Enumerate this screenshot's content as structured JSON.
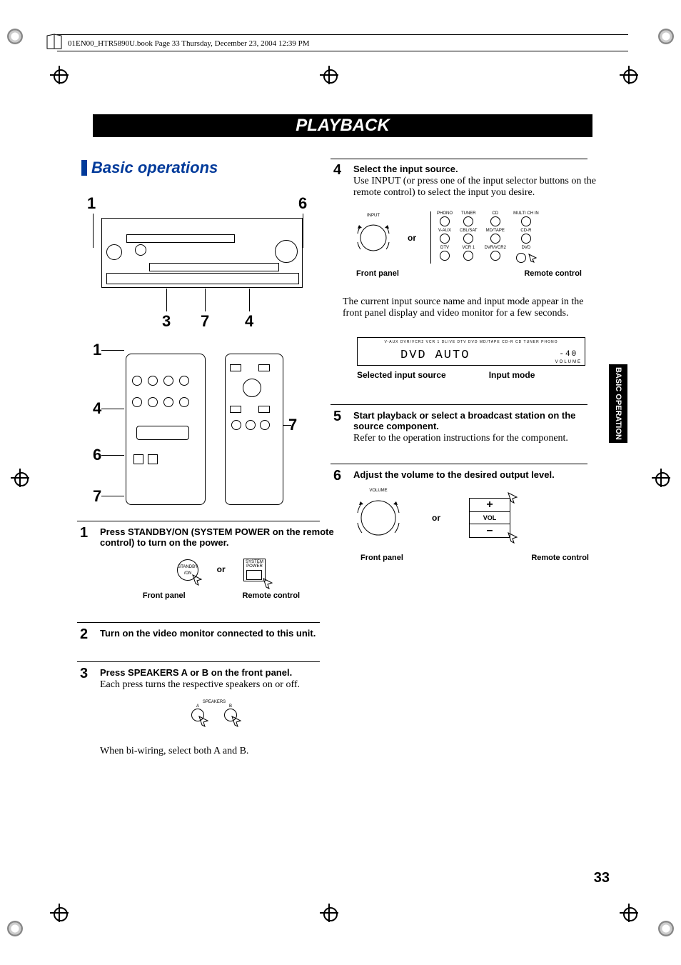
{
  "header_line": "01EN00_HTR5890U.book  Page 33  Thursday, December 23, 2004  12:39 PM",
  "title": "PLAYBACK",
  "section_title": "Basic operations",
  "side_tab": "BASIC OPERATION",
  "page_number": "33",
  "front_callouts": {
    "c1": "1",
    "c3": "3",
    "c4": "4",
    "c6": "6",
    "c7": "7",
    "r1": "1",
    "r4": "4",
    "r6": "6",
    "r7": "7",
    "r7b": "7"
  },
  "steps": {
    "s1": {
      "num": "1",
      "head": "Press STANDBY/ON (SYSTEM POWER on the remote control) to turn on the power.",
      "front_panel": "Front panel",
      "remote_control": "Remote control",
      "standby_label": "STANDBY\n/ON",
      "system_power_top": "SYSTEM",
      "system_power_bot": "POWER",
      "or": "or"
    },
    "s2": {
      "num": "2",
      "head": "Turn on the video monitor connected to this unit."
    },
    "s3": {
      "num": "3",
      "head": "Press SPEAKERS A or B on the front panel.",
      "body": "Each press turns the respective speakers on or off.",
      "body2": "When bi-wiring, select both A and B.",
      "speakers_lbl": "SPEAKERS",
      "a": "A",
      "b": "B"
    },
    "s4": {
      "num": "4",
      "head": "Select the input source.",
      "body": "Use INPUT (or press one of the input selector buttons on the remote control) to select the input you desire.",
      "input_lbl": "INPUT",
      "front_panel": "Front panel",
      "remote_control": "Remote control",
      "or": "or",
      "rc_inputs": [
        "PHONO",
        "TUNER",
        "CD",
        "MULTI CH IN",
        "V-AUX",
        "CBL/SAT",
        "MD/TAPE",
        "CD-R",
        "DTV",
        "VCR 1",
        "DVR/VCR2",
        "DVD"
      ],
      "body2": "The current input source name and input mode appear in the front panel display and video monitor for a few seconds.",
      "disp_labels": "V-AUX  DVR/VCR2  VCR 1  DLIVE  DTV  DVD  MD/TAPE  CD-R  CD  TUNER  PHONO",
      "disp_source": "DVD",
      "disp_mode": "AUTO",
      "disp_vol_lbl": "VOLUME",
      "disp_vol": "-40",
      "sel_src": "Selected input source",
      "inp_mode": "Input mode"
    },
    "s5": {
      "num": "5",
      "head": "Start playback or select a broadcast station on the source component.",
      "body": "Refer to the operation instructions for the component."
    },
    "s6": {
      "num": "6",
      "head": "Adjust the volume to the desired output level.",
      "vol_lbl": "VOLUME",
      "plus": "+",
      "vol": "VOL",
      "minus": "–",
      "front_panel": "Front panel",
      "remote_control": "Remote control",
      "or": "or"
    }
  }
}
